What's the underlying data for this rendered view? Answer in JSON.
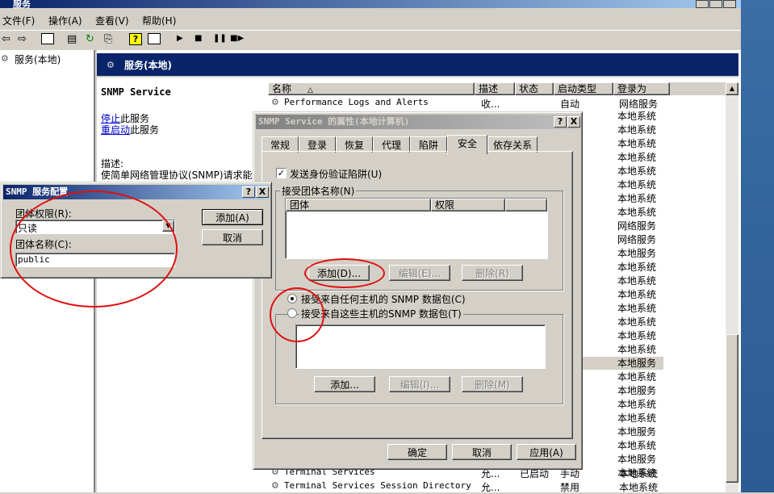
{
  "window": {
    "title": "服务"
  },
  "menu": [
    "文件(F)",
    "操作(A)",
    "查看(V)",
    "帮助(H)"
  ],
  "tree": {
    "root": "服务(本地)"
  },
  "header": {
    "title": "服务(本地)"
  },
  "desc_pane": {
    "service_name": "SNMP Service",
    "stop_link": "停止",
    "stop_suffix": "此服务",
    "restart_link": "重启动",
    "restart_suffix": "此服务",
    "desc_label": "描述:",
    "desc_text": "使简单网络管理协议(SNMP)请求能在"
  },
  "columns": {
    "name": "名称",
    "desc": "描述",
    "status": "状态",
    "startup": "启动类型",
    "logon": "登录为"
  },
  "rows_top": [
    {
      "name": "Performance Logs and Alerts",
      "desc": "收...",
      "status": "",
      "startup": "自动",
      "logon": "网络服务"
    }
  ],
  "logon_list": [
    "本地系统",
    "本地系统",
    "本地系统",
    "本地系统",
    "本地系统",
    "本地系统",
    "本地系统",
    "本地系统",
    "网络服务",
    "网络服务",
    "本地服务",
    "本地系统",
    "本地系统",
    "本地系统",
    "本地系统",
    "本地系统",
    "本地系统",
    "本地系统",
    "本地服务",
    "本地系统",
    "本地服务",
    "本地系统",
    "本地系统",
    "本地服务",
    "本地系统",
    "本地服务",
    "本地系统"
  ],
  "rows_bottom": [
    {
      "name": "Terminal Services",
      "desc": "允...",
      "status": "已启动",
      "startup": "手动",
      "logon": "本地系统"
    },
    {
      "name": "Terminal Services Session Directory",
      "desc": "允...",
      "status": "",
      "startup": "禁用",
      "logon": "本地系统"
    }
  ],
  "props": {
    "title": "SNMP Service 的属性(本地计算机)",
    "tabs": [
      "常规",
      "登录",
      "恢复",
      "代理",
      "陷阱",
      "安全",
      "依存关系"
    ],
    "active_tab": "安全",
    "send_trap_label": "发送身份验证陷阱(U)",
    "accepted_group": "接受团体名称(N)",
    "col_community": "团体",
    "col_rights": "权限",
    "add_btn": "添加(D)...",
    "edit_btn": "编辑(E)...",
    "remove_btn": "删除(R)",
    "radio_any": "接受来自任何主机的 SNMP 数据包(C)",
    "radio_these": "接受来自这些主机的SNMP 数据包(T)",
    "add_btn2": "添加...",
    "edit_btn2": "编辑(I)...",
    "remove_btn2": "删除(M)",
    "ok": "确定",
    "cancel": "取消",
    "apply": "应用(A)",
    "help_glyph": "?",
    "close_glyph": "X"
  },
  "snmp_cfg": {
    "title": "SNMP 服务配置",
    "rights_label": "团体权限(R):",
    "rights_value": "只读",
    "name_label": "团体名称(C):",
    "name_value": "public",
    "add": "添加(A)",
    "cancel": "取消"
  }
}
